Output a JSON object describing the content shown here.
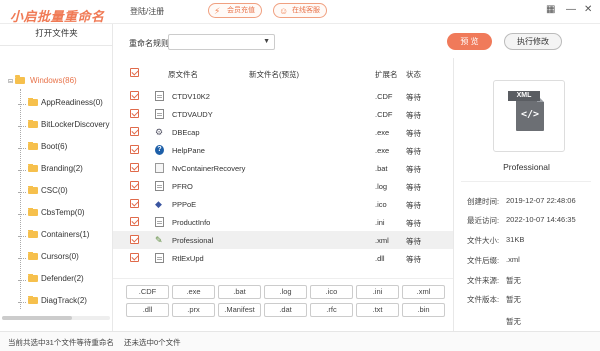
{
  "app": {
    "title": "小启批量重命名",
    "login": "登陆/注册",
    "pill_vip": "会员充值",
    "pill_service": "在线客服",
    "colors": {
      "accent": "#f07a5a",
      "folder": "#f6c04d"
    }
  },
  "sidebar": {
    "open_folder": "打开文件夹",
    "root": "Windows(86)",
    "items": [
      "AppReadiness(0)",
      "BitLockerDiscovery",
      "Boot(6)",
      "Branding(2)",
      "CSC(0)",
      "CbsTemp(0)",
      "Containers(1)",
      "Cursors(0)",
      "Defender(2)",
      "DiagTrack(2)"
    ]
  },
  "rule": {
    "label": "重命名规则",
    "value": ""
  },
  "actions": {
    "preview": "预 览",
    "execute": "执行修改"
  },
  "table": {
    "headers": {
      "original": "原文件名",
      "new": "新文件名(预览)",
      "ext": "扩展名",
      "status": "状态"
    },
    "rows": [
      {
        "name": "CTDV10K2",
        "ext": ".CDF",
        "status": "等待",
        "icon": "document-icon"
      },
      {
        "name": "CTDVAUDY",
        "ext": ".CDF",
        "status": "等待",
        "icon": "document-icon"
      },
      {
        "name": "DBEcap",
        "ext": ".exe",
        "status": "等待",
        "icon": "app-icon"
      },
      {
        "name": "HelpPane",
        "ext": ".exe",
        "status": "等待",
        "icon": "help-icon"
      },
      {
        "name": "NvContainerRecovery",
        "ext": ".bat",
        "status": "等待",
        "icon": "batch-icon"
      },
      {
        "name": "PFRO",
        "ext": ".log",
        "status": "等待",
        "icon": "document-icon"
      },
      {
        "name": "PPPoE",
        "ext": ".ico",
        "status": "等待",
        "icon": "image-icon"
      },
      {
        "name": "ProductInfo",
        "ext": ".ini",
        "status": "等待",
        "icon": "document-icon"
      },
      {
        "name": "Professional",
        "ext": ".xml",
        "status": "等待",
        "icon": "xml-icon"
      },
      {
        "name": "RtlExUpd",
        "ext": ".dll",
        "status": "等待",
        "icon": "document-icon"
      }
    ]
  },
  "extensions": [
    [
      ".CDF",
      ".exe",
      ".bat",
      ".log",
      ".ico",
      ".ini",
      ".xml"
    ],
    [
      ".dll",
      ".prx",
      ".Manifest",
      ".dat",
      ".rfc",
      ".txt",
      ".bin"
    ]
  ],
  "details": {
    "icon_tag": "XML",
    "icon_code": "</>",
    "file_name": "Professional",
    "props": [
      {
        "label": "创建时间:",
        "value": "2019-12-07 22:48:06"
      },
      {
        "label": "最近访问:",
        "value": "2022-10-07 14:46:35"
      },
      {
        "label": "文件大小:",
        "value": "31KB"
      },
      {
        "label": "文件后缀:",
        "value": ".xml"
      },
      {
        "label": "文件来源:",
        "value": "暂无"
      },
      {
        "label": "文件版本:",
        "value": "暂无"
      },
      {
        "label": "",
        "value": "暂无"
      }
    ]
  },
  "status": {
    "left": "当前共选中31个文件等待重命名",
    "right": "还未选中0个文件"
  }
}
